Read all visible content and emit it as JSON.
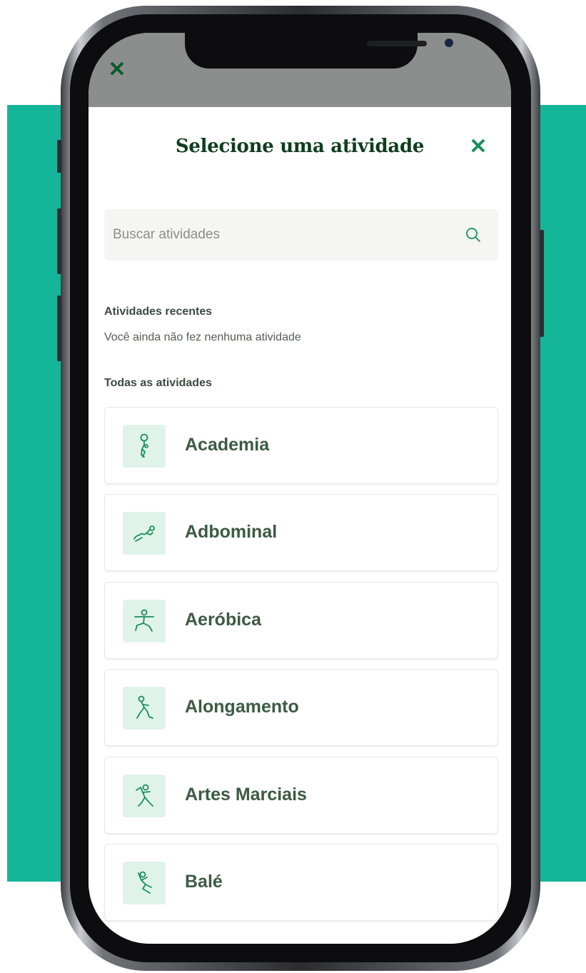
{
  "colors": {
    "accent": "#15b59a",
    "brand_dark_green": "#0f3d1f",
    "icon_green": "#1a8f5c",
    "icon_bg": "#e0f3e9"
  },
  "sheet": {
    "title": "Selecione uma atividade",
    "close_icon": "close-icon"
  },
  "search": {
    "placeholder": "Buscar atividades",
    "value": "",
    "icon": "search-icon"
  },
  "recent": {
    "heading": "Atividades recentes",
    "empty_message": "Você ainda não fez nenhuma atividade"
  },
  "all": {
    "heading": "Todas as atividades",
    "items": [
      {
        "label": "Academia",
        "icon": "weightlifting-icon"
      },
      {
        "label": "Adbominal",
        "icon": "abdominal-icon"
      },
      {
        "label": "Aeróbica",
        "icon": "aerobics-icon"
      },
      {
        "label": "Alongamento",
        "icon": "stretching-icon"
      },
      {
        "label": "Artes Marciais",
        "icon": "martial-arts-icon"
      },
      {
        "label": "Balé",
        "icon": "ballet-icon"
      }
    ]
  }
}
